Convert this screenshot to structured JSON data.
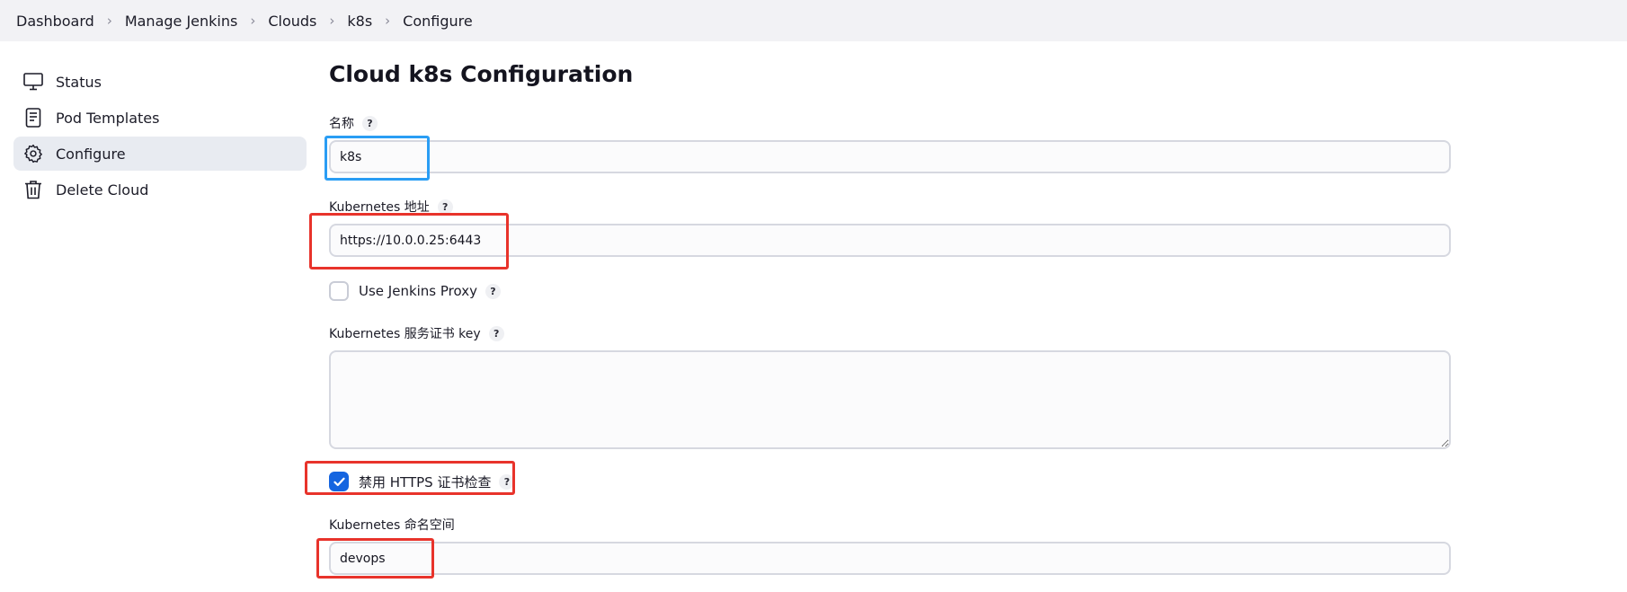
{
  "breadcrumb": {
    "items": [
      "Dashboard",
      "Manage Jenkins",
      "Clouds",
      "k8s",
      "Configure"
    ],
    "separator": ">"
  },
  "sidebar": {
    "items": [
      {
        "label": "Status",
        "icon": "monitor-icon"
      },
      {
        "label": "Pod Templates",
        "icon": "document-icon"
      },
      {
        "label": "Configure",
        "icon": "gear-icon",
        "active": true
      },
      {
        "label": "Delete Cloud",
        "icon": "trash-icon"
      }
    ]
  },
  "main": {
    "title": "Cloud k8s Configuration",
    "help_label": "?",
    "fields": {
      "name": {
        "label": "名称",
        "value": "k8s"
      },
      "url": {
        "label": "Kubernetes 地址",
        "value": "https://10.0.0.25:6443"
      },
      "use_proxy": {
        "label": "Use Jenkins Proxy",
        "checked": false
      },
      "cert_key": {
        "label": "Kubernetes 服务证书 key",
        "value": ""
      },
      "skip_tls": {
        "label": "禁用 HTTPS 证书检查",
        "checked": true
      },
      "namespace": {
        "label": "Kubernetes 命名空间",
        "value": "devops"
      }
    }
  },
  "colors": {
    "annotation_red": "#e8332b",
    "annotation_blue": "#2a9df4",
    "checkbox_blue": "#1565e0"
  }
}
